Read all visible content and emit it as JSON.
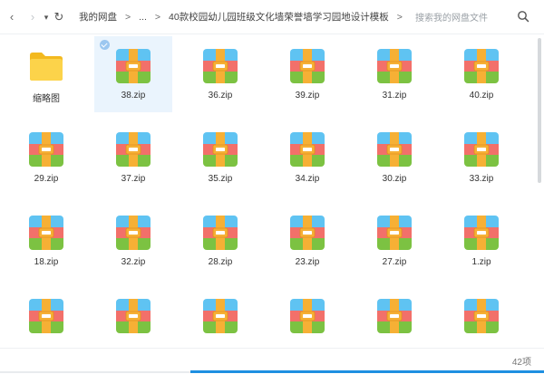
{
  "nav": {
    "back_icon": "chevron-left-icon",
    "forward_icon": "chevron-right-icon",
    "dropdown_icon": "caret-down-icon",
    "refresh_icon": "refresh-icon",
    "back_glyph": "‹",
    "forward_glyph": "›",
    "dropdown_glyph": "▾",
    "refresh_glyph": "↻"
  },
  "breadcrumb": {
    "root": "我的网盘",
    "ellipsis": "...",
    "current": "40款校园幼儿园班级文化墙荣誉墙学习园地设计模板",
    "separator": ">"
  },
  "search": {
    "placeholder": "搜索我的网盘文件",
    "icon": "search-icon"
  },
  "items": [
    {
      "label": "缩略图",
      "type": "folder"
    },
    {
      "label": "38.zip",
      "type": "zip",
      "selected": true
    },
    {
      "label": "36.zip",
      "type": "zip"
    },
    {
      "label": "39.zip",
      "type": "zip"
    },
    {
      "label": "31.zip",
      "type": "zip"
    },
    {
      "label": "40.zip",
      "type": "zip"
    },
    {
      "label": "29.zip",
      "type": "zip"
    },
    {
      "label": "37.zip",
      "type": "zip"
    },
    {
      "label": "35.zip",
      "type": "zip"
    },
    {
      "label": "34.zip",
      "type": "zip"
    },
    {
      "label": "30.zip",
      "type": "zip"
    },
    {
      "label": "33.zip",
      "type": "zip"
    },
    {
      "label": "18.zip",
      "type": "zip"
    },
    {
      "label": "32.zip",
      "type": "zip"
    },
    {
      "label": "28.zip",
      "type": "zip"
    },
    {
      "label": "23.zip",
      "type": "zip"
    },
    {
      "label": "27.zip",
      "type": "zip"
    },
    {
      "label": "1.zip",
      "type": "zip"
    },
    {
      "label": "",
      "type": "zip"
    },
    {
      "label": "",
      "type": "zip"
    },
    {
      "label": "",
      "type": "zip"
    },
    {
      "label": "",
      "type": "zip"
    },
    {
      "label": "",
      "type": "zip"
    },
    {
      "label": "",
      "type": "zip"
    }
  ],
  "status": {
    "count": "42项"
  },
  "colors": {
    "accent": "#1e8fe1",
    "selected_bg": "#eaf4fd",
    "zip_top": "#5fc3f2",
    "zip_mid": "#f2706a",
    "zip_bottom": "#7cc242",
    "zip_strap": "#f6b035",
    "folder": "#fcd34a"
  }
}
